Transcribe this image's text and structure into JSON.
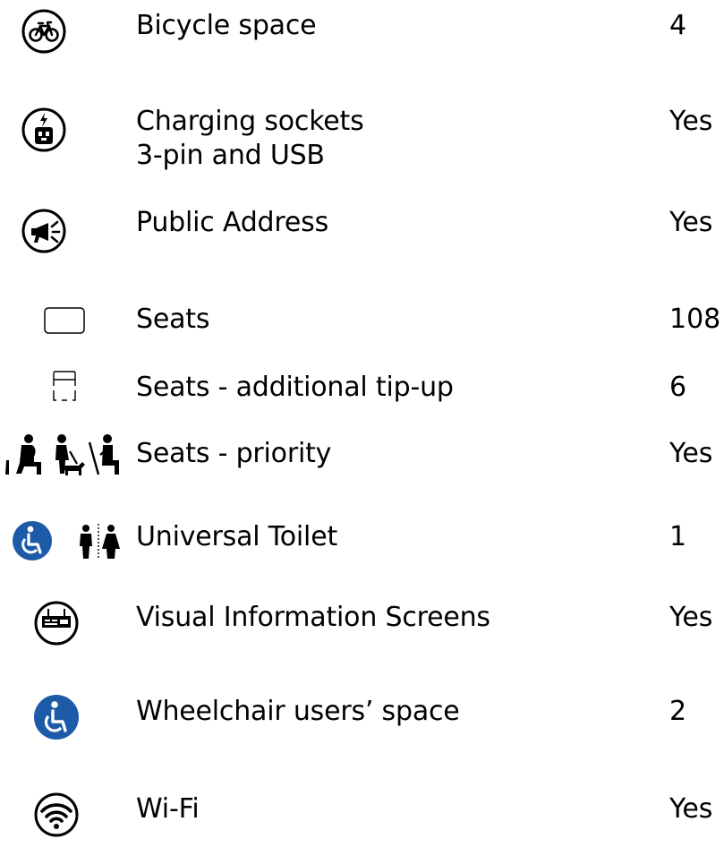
{
  "colors": {
    "text": "#000000",
    "accessibility_blue": "#1d5ba8",
    "icon_gray": "#555555"
  },
  "facilities": [
    {
      "icon": "bicycle-icon",
      "label_lines": [
        "Bicycle space"
      ],
      "value": "4"
    },
    {
      "icon": "charging-socket-icon",
      "label_lines": [
        "Charging sockets",
        "3-pin and USB"
      ],
      "value": "Yes"
    },
    {
      "icon": "megaphone-icon",
      "label_lines": [
        "Public Address"
      ],
      "value": "Yes"
    },
    {
      "icon": "seat-icon",
      "label_lines": [
        "Seats"
      ],
      "value": "108"
    },
    {
      "icon": "tip-up-seat-icon",
      "label_lines": [
        "Seats - additional tip-up"
      ],
      "value": "6"
    },
    {
      "icon": "priority-seat-icon",
      "label_lines": [
        "Seats - priority"
      ],
      "value": "Yes"
    },
    {
      "icon": "accessible-toilet-icon",
      "label_lines": [
        "Universal Toilet"
      ],
      "value": "1"
    },
    {
      "icon": "information-screen-icon",
      "label_lines": [
        "Visual Information Screens"
      ],
      "value": "Yes"
    },
    {
      "icon": "wheelchair-icon",
      "label_lines": [
        "Wheelchair users’ space"
      ],
      "value": "2"
    },
    {
      "icon": "wifi-icon",
      "label_lines": [
        "Wi-Fi"
      ],
      "value": "Yes"
    }
  ]
}
